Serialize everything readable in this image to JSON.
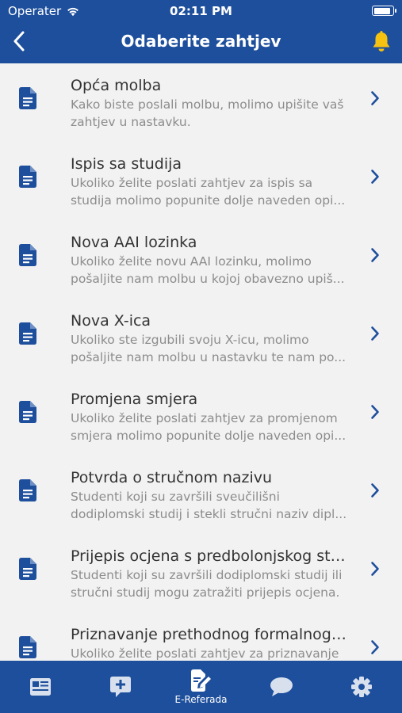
{
  "status_bar": {
    "carrier": "Operater",
    "time": "02:11 PM",
    "battery_level": 0.95
  },
  "nav": {
    "title": "Odaberite zahtjev",
    "back_icon": "chevron-left-icon",
    "bell_icon": "bell-icon"
  },
  "colors": {
    "header": "#1e4f9c",
    "accent_icon": "#1e4f9c",
    "bell": "#f5c211",
    "background": "#f2f2f2"
  },
  "requests": [
    {
      "title": "Opća molba",
      "description": "Kako biste poslali molbu, molimo upišite vaš zahtjev u nastavku."
    },
    {
      "title": "Ispis sa studija",
      "description": "Ukoliko želite poslati zahtjev za ispis sa studija molimo popunite dolje naveden opi..."
    },
    {
      "title": "Nova AAI lozinka",
      "description": "Ukoliko želite novu AAI lozinku, molimo pošaljite nam molbu u kojoj obavezno upiš..."
    },
    {
      "title": "Nova X-ica",
      "description": "Ukoliko ste izgubili svoju X-icu, molimo pošaljite nam molbu u nastavku te nam po..."
    },
    {
      "title": "Promjena smjera",
      "description": "Ukoliko želite poslati zahtjev za promjenom smjera molimo popunite dolje naveden opi..."
    },
    {
      "title": "Potvrda o stručnom nazivu",
      "description": "Studenti koji su završili sveučilišni dodiplomski studij i stekli stručni naziv dipl..."
    },
    {
      "title": "Prijepis ocjena s predbolonjskog studija",
      "description": "Studenti koji su završili dodiplomski studij ili stručni studij mogu zatražiti prijepis ocjena."
    },
    {
      "title": "Priznavanje prethodnog formalnog uč...",
      "description": "Ukoliko želite poslati zahtjev za priznavanje"
    }
  ],
  "tabbar": {
    "tabs": [
      {
        "name": "tab-news",
        "icon": "news-card-icon",
        "label": ""
      },
      {
        "name": "tab-add-request",
        "icon": "add-message-icon",
        "label": ""
      },
      {
        "name": "tab-e-referada",
        "icon": "edit-document-icon",
        "label": "E-Referada",
        "active": true
      },
      {
        "name": "tab-chat",
        "icon": "chat-bubble-icon",
        "label": ""
      },
      {
        "name": "tab-settings",
        "icon": "gear-icon",
        "label": ""
      }
    ]
  }
}
